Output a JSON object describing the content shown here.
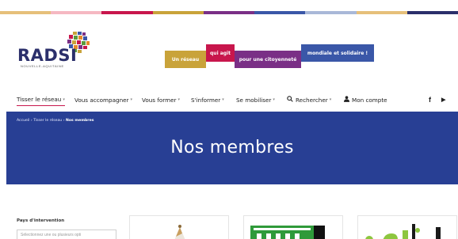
{
  "top_color_bar": [
    "#e6c07a",
    "#f5b8c2",
    "#c8164c",
    "#c9a33a",
    "#7a2f86",
    "#3a57a8",
    "#a9b8d8",
    "#e6c07a",
    "#2b2f6b"
  ],
  "logo": {
    "text": "RADSI",
    "subtitle": "NOUVELLE-AQUITAINE",
    "icon": "globe-mosaic-icon"
  },
  "tagline": [
    {
      "text": "Un réseau",
      "color": "#c9a33a"
    },
    {
      "text": "qui agit",
      "color": "#c8164c"
    },
    {
      "text": "pour une citoyenneté",
      "color": "#7a2f86"
    },
    {
      "text": "mondiale et solidaire !",
      "color": "#3a57a8"
    }
  ],
  "nav": {
    "items": [
      {
        "label": "Tisser le réseau"
      },
      {
        "label": "Vous accompagner"
      },
      {
        "label": "Vous former"
      },
      {
        "label": "S'informer"
      },
      {
        "label": "Se mobiliser"
      },
      {
        "label": "Rechercher",
        "icon": "search-icon"
      },
      {
        "label": "Mon compte",
        "icon": "user-icon"
      }
    ],
    "social": [
      {
        "label": "f",
        "icon": "facebook-icon"
      },
      {
        "label": "▶",
        "icon": "youtube-icon"
      }
    ]
  },
  "breadcrumb": {
    "items": [
      "Accueil",
      "Tisser le réseau",
      "Nos membres"
    ],
    "separator": "›"
  },
  "page": {
    "title": "Nos membres"
  },
  "filter": {
    "label": "Pays d'intervention",
    "placeholder": "Sélectionnez une ou plusieurs opti"
  },
  "colors": {
    "banner": "#283f94",
    "nav_active": "#c8164c"
  }
}
